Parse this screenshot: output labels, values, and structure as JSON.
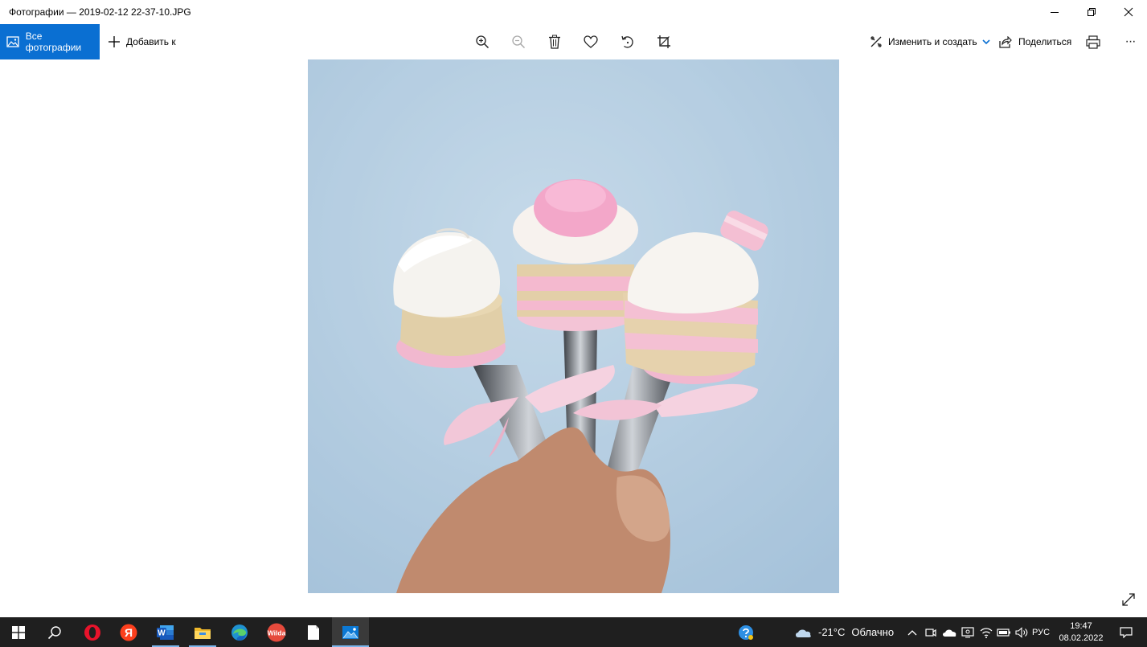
{
  "window": {
    "title": "Фотографии — 2019-02-12 22-37-10.JPG",
    "controls": [
      "minimize-icon",
      "restore-icon",
      "close-icon"
    ]
  },
  "toolbar": {
    "all_photos_label": "Все фотографии",
    "add_to_label": "Добавить к",
    "tools": [
      "zoom-in-icon",
      "zoom-out-icon",
      "delete-icon",
      "favorite-icon",
      "rotate-icon",
      "crop-icon"
    ],
    "edit_create_label": "Изменить и создать",
    "share_label": "Поделиться",
    "more_label": "···"
  },
  "colors": {
    "accent": "#0a6fd2",
    "taskbar": "#1f1f1f"
  },
  "taskbar": {
    "apps": [
      "start-icon",
      "search-icon",
      "opera-icon",
      "yandex-icon",
      "word-icon",
      "file-explorer-icon",
      "edge-icon",
      "wilda-icon",
      "document-icon",
      "photos-icon"
    ],
    "yandex_letter": "Я",
    "word_letter": "W",
    "wilda_label": "Wilda",
    "weather": {
      "temperature": "-21°C",
      "condition": "Облачно"
    },
    "language": "РУС",
    "time": "19:47",
    "date": "08.02.2022"
  }
}
